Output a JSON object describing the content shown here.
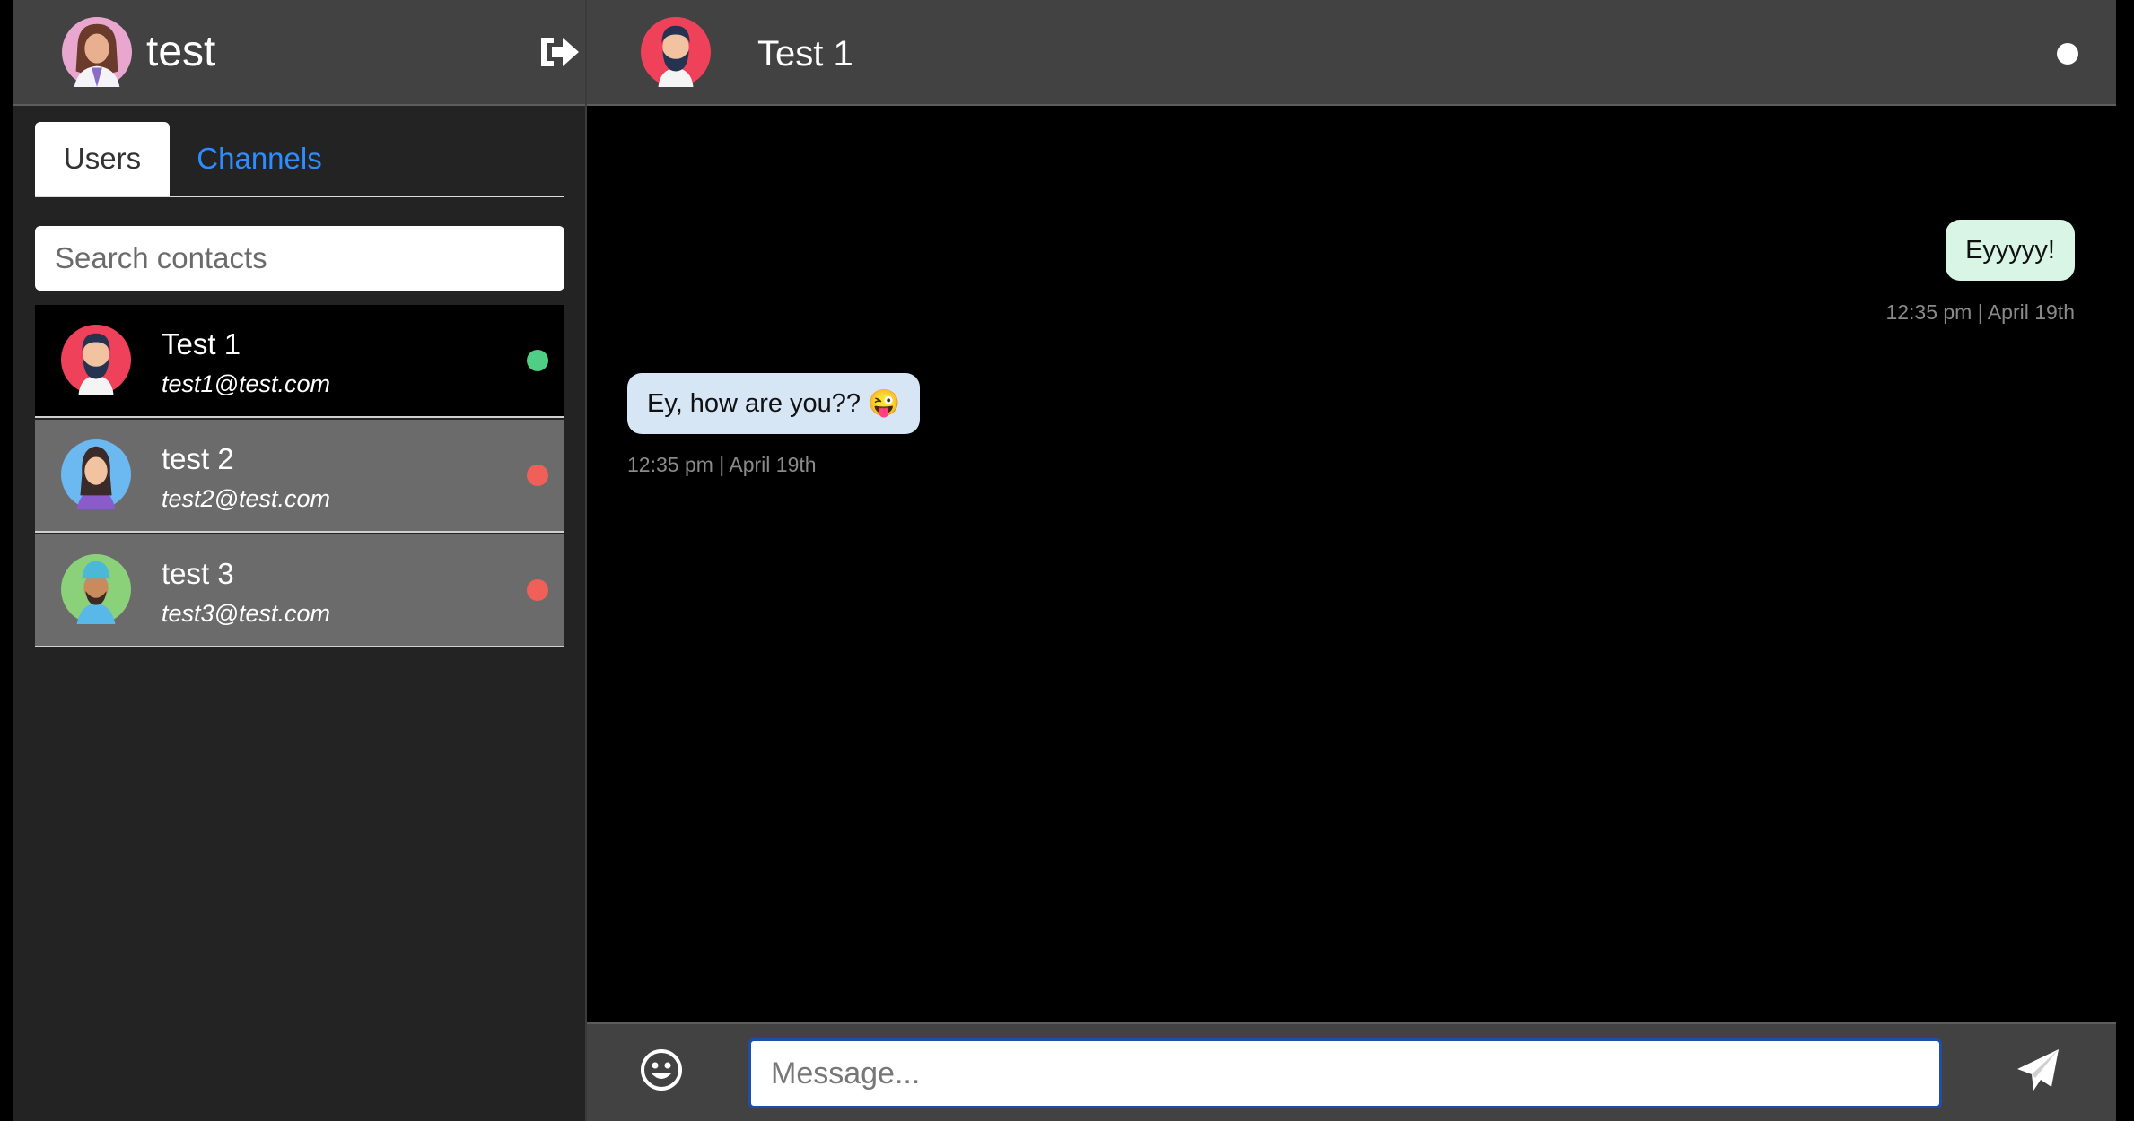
{
  "me": {
    "name": "test"
  },
  "tabs": [
    {
      "label": "Users",
      "active": true
    },
    {
      "label": "Channels",
      "active": false
    }
  ],
  "search": {
    "placeholder": "Search contacts"
  },
  "contacts": [
    {
      "name": "Test 1",
      "email": "test1@test.com",
      "status": "online",
      "status_color": "#4fcf86",
      "active": true
    },
    {
      "name": "test 2",
      "email": "test2@test.com",
      "status": "offline",
      "status_color": "#f06058",
      "active": false
    },
    {
      "name": "test 3",
      "email": "test3@test.com",
      "status": "offline",
      "status_color": "#f06058",
      "active": false
    }
  ],
  "chat": {
    "peer_name": "Test 1",
    "messages": [
      {
        "direction": "outgoing",
        "text": "Eyyyyy!",
        "time": "12:35 pm | April 19th"
      },
      {
        "direction": "incoming",
        "text": "Ey, how are you?? 😜",
        "time": "12:35 pm | April 19th"
      }
    ],
    "composer": {
      "placeholder": "Message..."
    }
  },
  "icons": {
    "logout": "logout-icon",
    "emoji": "smiley-icon",
    "send": "paper-plane-icon"
  },
  "colors": {
    "accent": "#2d8cff",
    "online": "#4fcf86",
    "offline": "#f06058",
    "outgoing_bubble": "#d8f5e6",
    "incoming_bubble": "#d6e6f5"
  }
}
